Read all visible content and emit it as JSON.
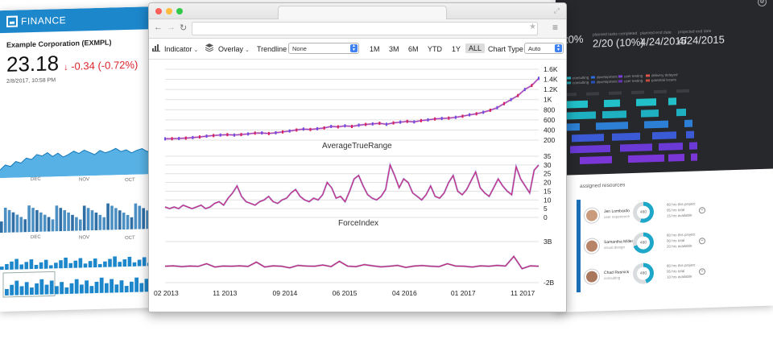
{
  "finance": {
    "brand": "FINANCE",
    "company": "Example Corporation (EXMPL)",
    "price": "23.18",
    "change": "-0.34 (-0.72%)",
    "change_arrow": "↓",
    "timestamp": "2/8/2017, 10:58 PM",
    "axis1": [
      "DEC",
      "NOV",
      "OCT"
    ],
    "axis2": [
      "DEC",
      "NOV",
      "OCT"
    ],
    "colors": {
      "header": "#1d87cc",
      "down": "#d8242b",
      "area": "#1d87cc"
    }
  },
  "browser": {
    "url": "",
    "toolbar": {
      "indicator": "Indicator",
      "overlay": "Overlay",
      "trendline_label": "Trendline",
      "trendline_value": "None",
      "ranges": [
        "1M",
        "3M",
        "6M",
        "YTD",
        "1Y",
        "ALL"
      ],
      "active_range": "ALL",
      "chart_type_label": "Chart Type",
      "chart_type_value": "Auto"
    }
  },
  "dashboard": {
    "stats": [
      {
        "label": "planned tasks completed",
        "value": "2/20 (10%)"
      },
      {
        "label": "planned end date",
        "value": "4/24/2015"
      },
      {
        "label": "projected end date",
        "value": "4/24/2015"
      }
    ],
    "partial_stat": "t0%",
    "legend": [
      "consulting",
      "development",
      "user testing",
      "delivery delayed",
      "consulting",
      "development",
      "user testing",
      "potential issues"
    ],
    "assigned_title": "assigned resources",
    "resources": [
      {
        "name": "Jen Lombardo",
        "role": "user experience",
        "hours": "480",
        "percent": 0.55,
        "lines": [
          "80 hrs this project",
          "95 hrs total",
          "15 hrs available"
        ]
      },
      {
        "name": "Samantha Miller",
        "role": "visual design",
        "hours": "480",
        "percent": 0.7,
        "lines": [
          "80 hrs this project",
          "90 hrs total",
          "20 hrs available"
        ]
      },
      {
        "name": "Chad Resnick",
        "role": "consulting",
        "hours": "480",
        "percent": 0.45,
        "lines": [
          "80 hrs this project",
          "95 hrs total",
          "10 hrs available"
        ]
      }
    ]
  },
  "chart_data": [
    {
      "type": "line",
      "title": "",
      "x_ticks": [
        "02 2013",
        "11 2013",
        "09 2014",
        "06 2015",
        "04 2016",
        "01 2017",
        "11 2017"
      ],
      "y_ticks": [
        "200",
        "400",
        "600",
        "800",
        "1K",
        "1.2K",
        "1.4K",
        "1.6K"
      ],
      "ylim": [
        200,
        1600
      ],
      "series": [
        {
          "values": [
            225,
            228,
            232,
            240,
            250,
            262,
            278,
            290,
            300,
            308,
            300,
            310,
            322,
            338,
            342,
            330,
            345,
            362,
            380,
            400,
            418,
            410,
            425,
            440,
            470,
            462,
            482,
            470,
            495,
            510,
            520,
            532,
            512,
            540,
            555,
            570,
            560,
            585,
            600,
            618,
            628,
            635,
            650,
            672,
            700,
            720,
            750,
            790,
            840,
            920,
            1000,
            1080,
            1200,
            1280,
            1420
          ]
        }
      ]
    },
    {
      "type": "line",
      "title": "AverageTrueRange",
      "y_ticks": [
        "0",
        "5",
        "10",
        "15",
        "20",
        "25",
        "30",
        "35"
      ],
      "ylim": [
        0,
        35
      ],
      "series": [
        {
          "values": [
            6,
            5,
            6,
            5,
            7,
            6,
            5,
            6,
            7,
            5,
            6,
            8,
            9,
            7,
            11,
            14,
            18,
            12,
            9,
            8,
            7,
            9,
            10,
            12,
            9,
            8,
            10,
            11,
            14,
            16,
            12,
            10,
            9,
            11,
            10,
            13,
            20,
            17,
            11,
            12,
            9,
            15,
            22,
            24,
            18,
            13,
            11,
            10,
            12,
            16,
            30,
            24,
            17,
            22,
            20,
            14,
            12,
            10,
            13,
            18,
            12,
            11,
            14,
            20,
            24,
            15,
            13,
            16,
            21,
            26,
            17,
            14,
            12,
            17,
            22,
            18,
            15,
            13,
            29,
            22,
            18,
            14,
            27,
            30
          ]
        }
      ]
    },
    {
      "type": "line",
      "title": "ForceIndex",
      "y_ticks": [
        "3B",
        "-2B"
      ],
      "ylim": [
        -2,
        3
      ],
      "series": [
        {
          "values": [
            0,
            0.05,
            -0.05,
            0.02,
            -0.02,
            0.3,
            -0.1,
            0.02,
            0,
            0.05,
            -0.03,
            0.5,
            -0.1,
            0.05,
            0,
            -0.2,
            0.1,
            0.02,
            0,
            0.15,
            -0.05,
            0.6,
            0,
            -0.05,
            0.2,
            0.05,
            -0.08,
            0,
            0.1,
            -0.15,
            0.02,
            0.08,
            0,
            -0.05,
            0.3,
            0.02,
            0,
            -0.1,
            0.05,
            0,
            0.1,
            0.02,
            1.2,
            -0.3,
            0.05,
            0
          ]
        }
      ]
    }
  ]
}
